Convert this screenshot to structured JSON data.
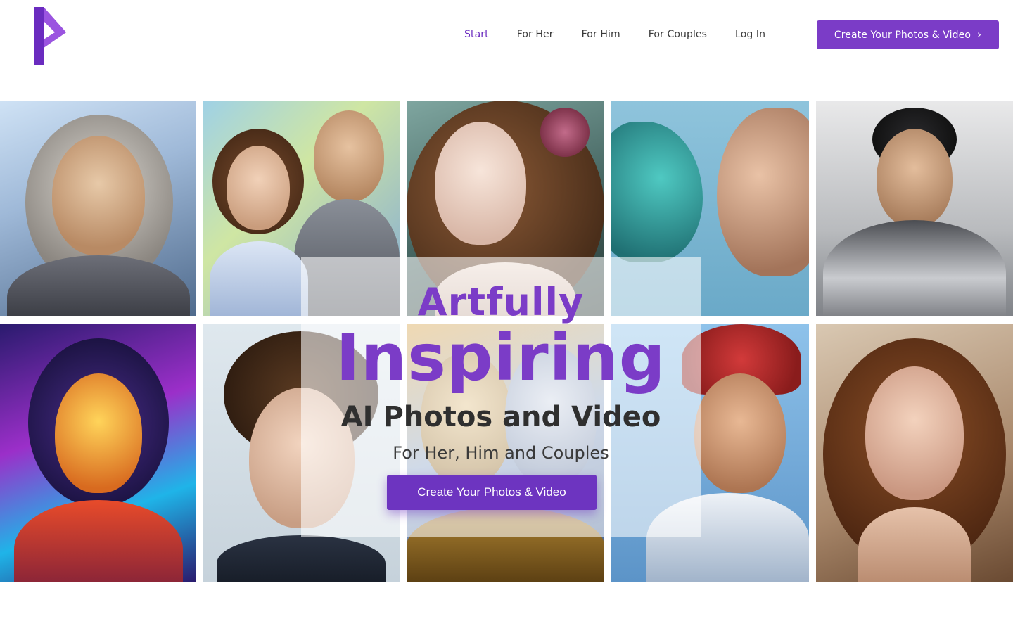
{
  "header": {
    "logo_icon": "p-logo-icon",
    "nav": [
      {
        "label": "Start",
        "active": true
      },
      {
        "label": "For Her",
        "active": false
      },
      {
        "label": "For Him",
        "active": false
      },
      {
        "label": "For Couples",
        "active": false
      },
      {
        "label": "Log In",
        "active": false
      }
    ],
    "cta_label": "Create Your Photos & Video",
    "cta_icon": "chevron-right-icon"
  },
  "gallery": {
    "tiles": [
      {
        "subject": "bearded-warrior-portrait"
      },
      {
        "subject": "couple-formal-portrait"
      },
      {
        "subject": "woman-with-flowers-portrait"
      },
      {
        "subject": "mosaic-faces-portrait"
      },
      {
        "subject": "armored-hero-portrait"
      },
      {
        "subject": "cyber-heroine-portrait"
      },
      {
        "subject": "curly-hair-man-portrait"
      },
      {
        "subject": "golden-couple-portrait"
      },
      {
        "subject": "baseball-player-portrait"
      },
      {
        "subject": "fairy-woman-portrait"
      }
    ]
  },
  "hero": {
    "line1": "Artfully",
    "line2": "Inspiring",
    "line3": "AI Photos and Video",
    "line4": "For Her, Him and Couples",
    "cta_label": "Create Your Photos & Video"
  },
  "colors": {
    "accent": "#7b3cc7",
    "accent_dark": "#6d34c0",
    "nav_active": "#6a2bbf",
    "text_dark": "#2f2f2f"
  }
}
